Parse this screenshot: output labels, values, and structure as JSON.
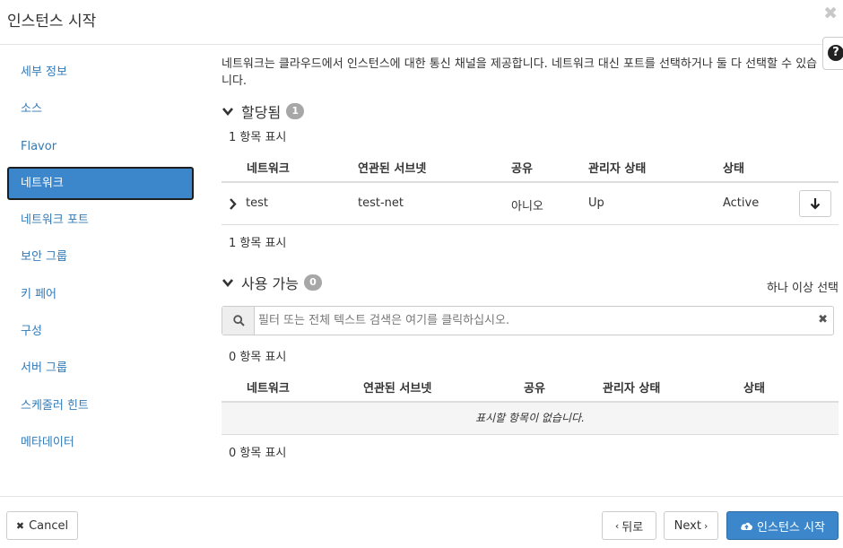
{
  "header": {
    "title": "인스턴스 시작",
    "close_glyph": "✖",
    "help_glyph": "?"
  },
  "nav": {
    "items": [
      {
        "label": "세부 정보"
      },
      {
        "label": "소스"
      },
      {
        "label": "Flavor"
      },
      {
        "label": "네트워크",
        "active": true
      },
      {
        "label": "네트워크 포트"
      },
      {
        "label": "보안 그룹"
      },
      {
        "label": "키 페어"
      },
      {
        "label": "구성"
      },
      {
        "label": "서버 그룹"
      },
      {
        "label": "스케줄러 힌트"
      },
      {
        "label": "메타데이터"
      }
    ]
  },
  "main": {
    "intro": "네트워크는 클라우드에서 인스턴스에 대한 통신 채널을 제공합니다. 네트워크 대신 포트를 선택하거나 둘 다 선택할 수 있습니다.",
    "allocated": {
      "title": "할당됨",
      "badge": "1",
      "count_top": "1 항목 표시",
      "count_bottom": "1 항목 표시",
      "columns": [
        "네트워크",
        "연관된 서브넷",
        "공유",
        "관리자 상태",
        "상태"
      ],
      "rows": [
        {
          "network": "test",
          "subnet": "test-net",
          "shared": "아니오",
          "admin_state": "Up",
          "status": "Active"
        }
      ]
    },
    "available": {
      "title": "사용 가능",
      "badge": "0",
      "select_hint": "하나 이상 선택",
      "search_placeholder": "필터 또는 전체 텍스트 검색은 여기를 클릭하십시오.",
      "count_top": "0 항목 표시",
      "count_bottom": "0 항목 표시",
      "columns": [
        "네트워크",
        "연관된 서브넷",
        "공유",
        "관리자 상태",
        "상태"
      ],
      "empty_text": "표시할 항목이 없습니다."
    }
  },
  "footer": {
    "cancel_label": "Cancel",
    "back_label": "뒤로",
    "next_label": "Next",
    "launch_label": "인스턴스 시작"
  },
  "colors": {
    "accent": "#3c87cb",
    "link": "#337ab7",
    "badge": "#a7a7a7"
  }
}
